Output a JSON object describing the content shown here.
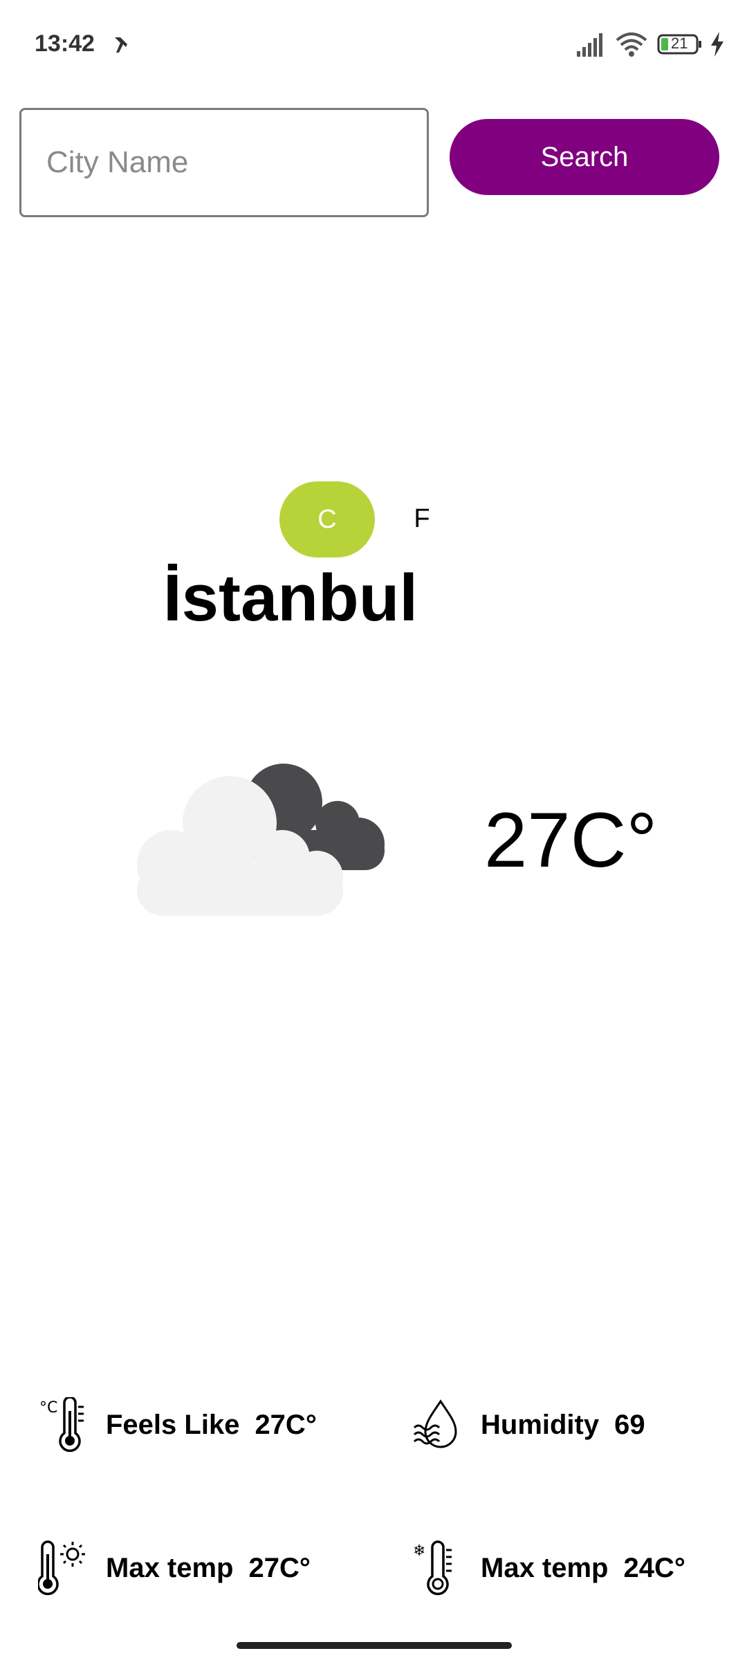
{
  "status_bar": {
    "time": "13:42",
    "battery": "21"
  },
  "search": {
    "placeholder": "City Name",
    "value": "",
    "button_label": "Search"
  },
  "units": {
    "celsius_label": "C",
    "fahrenheit_label": "F",
    "selected": "C"
  },
  "weather": {
    "city": "İstanbul",
    "temperature": "27C°",
    "icon": "cloudy-icon"
  },
  "details": {
    "feels_like": {
      "label": "Feels Like",
      "value": "27C°",
      "icon": "thermometer-celsius-icon"
    },
    "humidity": {
      "label": "Humidity",
      "value": "69",
      "icon": "humidity-icon"
    },
    "max_temp": {
      "label": "Max temp",
      "value": "27C°",
      "icon": "thermometer-sun-icon"
    },
    "min_temp": {
      "label": "Max temp",
      "value": "24C°",
      "icon": "thermometer-snow-icon"
    }
  },
  "colors": {
    "search_button": "#800080",
    "unit_selected": "#b8d33a",
    "cloud_light": "#f2f2f2",
    "cloud_dark": "#4a4a4c"
  }
}
